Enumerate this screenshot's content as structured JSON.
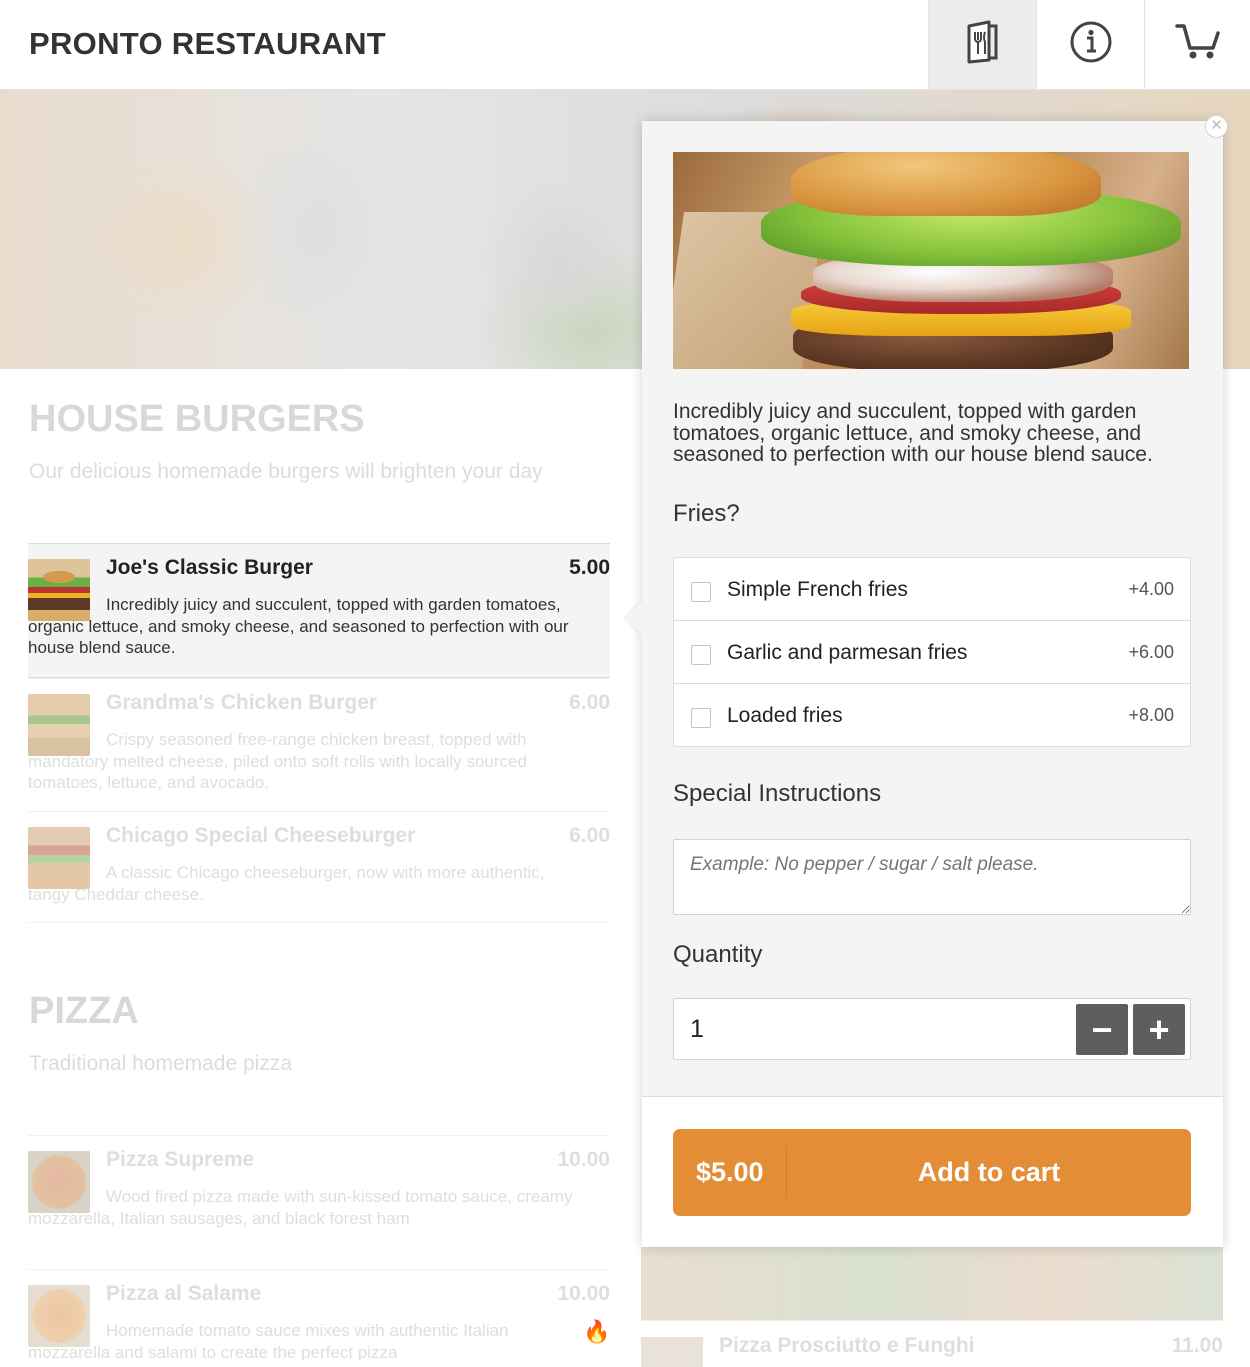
{
  "header": {
    "brand": "PRONTO RESTAURANT",
    "nav": [
      {
        "icon": "menu-book-icon",
        "active": true
      },
      {
        "icon": "info-icon",
        "active": false
      },
      {
        "icon": "cart-icon",
        "active": false
      }
    ]
  },
  "menu": {
    "categories": [
      {
        "title": "HOUSE BURGERS",
        "description": "Our delicious homemade burgers will brighten your day",
        "items": [
          {
            "name": "Joe's Classic Burger",
            "price": "5.00",
            "description": "Incredibly juicy and succulent, topped with garden tomatoes, organic lettuce, and smoky cheese, and seasoned to perfection with our house blend sauce.",
            "selected": true
          },
          {
            "name": "Grandma's Chicken Burger",
            "price": "6.00",
            "description": "Crispy seasoned free-range chicken breast, topped with mandatory melted cheese, piled onto soft rolls with locally sourced tomatoes, lettuce, and avocado."
          },
          {
            "name": "Chicago Special Cheeseburger",
            "price": "6.00",
            "description": "A classic Chicago cheeseburger, now with more authentic, tangy Cheddar cheese."
          }
        ]
      },
      {
        "title": "PIZZA",
        "description": "Traditional homemade pizza",
        "items": [
          {
            "name": "Pizza Supreme",
            "price": "10.00",
            "description": "Wood fired pizza made with sun-kissed tomato sauce, creamy mozzarella, Italian sausages, and black forest ham"
          },
          {
            "name": "Pizza al Salame",
            "price": "10.00",
            "description": "Homemade tomato sauce mixes with authentic Italian mozzarella and salami to create the perfect pizza"
          },
          {
            "name": "Pizza Prosciutto e Funghi",
            "price": "11.00"
          }
        ]
      }
    ]
  },
  "popup": {
    "description": "Incredibly juicy and succulent, topped with garden tomatoes, organic lettuce, and smoky cheese, and seasoned to perfection with our house blend sauce.",
    "options_title": "Fries?",
    "options": [
      {
        "label": "Simple French fries",
        "price": "+4.00",
        "checked": false
      },
      {
        "label": "Garlic and parmesan fries",
        "price": "+6.00",
        "checked": false
      },
      {
        "label": "Loaded fries",
        "price": "+8.00",
        "checked": false
      }
    ],
    "instructions_title": "Special Instructions",
    "instructions_placeholder": "Example: No pepper / sugar / salt please.",
    "quantity_title": "Quantity",
    "quantity": "1",
    "minus": "−",
    "plus": "+",
    "total": "$5.00",
    "add_label": "Add to cart",
    "accent": "#e38d36"
  }
}
